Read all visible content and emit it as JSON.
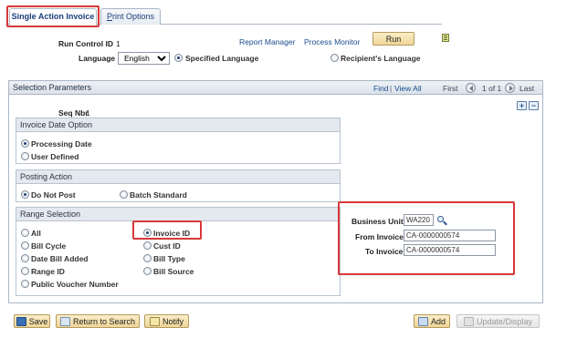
{
  "tabs": [
    {
      "label": "Single Action Invoice",
      "active": true
    },
    {
      "label": "Print Options",
      "accesskey_char": "P",
      "rest": "rint Options",
      "active": false
    }
  ],
  "header": {
    "run_control_label": "Run Control ID",
    "run_control_value": "1",
    "report_manager": "Report Manager",
    "process_monitor": "Process Monitor",
    "run_button": "Run",
    "language_label": "Language",
    "language_value": "English",
    "specified_language": "Specified Language",
    "recipients_language": "Recipient's Language"
  },
  "selection": {
    "title": "Selection Parameters",
    "find": "Find",
    "view_all": "View All",
    "first": "First",
    "counter": "1 of 1",
    "last": "Last",
    "seq_label": "Seq Nbr",
    "seq_value": "1"
  },
  "invoice_date": {
    "title": "Invoice Date Option",
    "options": [
      "Processing Date",
      "User Defined"
    ],
    "selected": "Processing Date"
  },
  "posting": {
    "title": "Posting Action",
    "options": [
      "Do Not Post",
      "Batch Standard"
    ],
    "selected": "Do Not Post"
  },
  "range": {
    "title": "Range Selection",
    "left_options": [
      "All",
      "Bill Cycle",
      "Date Bill Added",
      "Range ID",
      "Public Voucher Number"
    ],
    "right_options": [
      "Invoice ID",
      "Cust ID",
      "Bill Type",
      "Bill Source"
    ],
    "selected": "Invoice ID"
  },
  "fields": {
    "business_unit_label": "Business Unit",
    "business_unit_value": "WA220",
    "from_invoice_label": "From Invoice",
    "from_invoice_value": "CA-0000000574",
    "to_invoice_label": "To Invoice",
    "to_invoice_value": "CA-0000000574"
  },
  "footer": {
    "save": "Save",
    "return_to_search": "Return to Search",
    "notify": "Notify",
    "add": "Add",
    "update_display": "Update/Display"
  },
  "colors": {
    "highlight": "#d9383a",
    "panel_border": "#aab7c6",
    "link": "#1b4c8c",
    "button": "#efd597"
  }
}
